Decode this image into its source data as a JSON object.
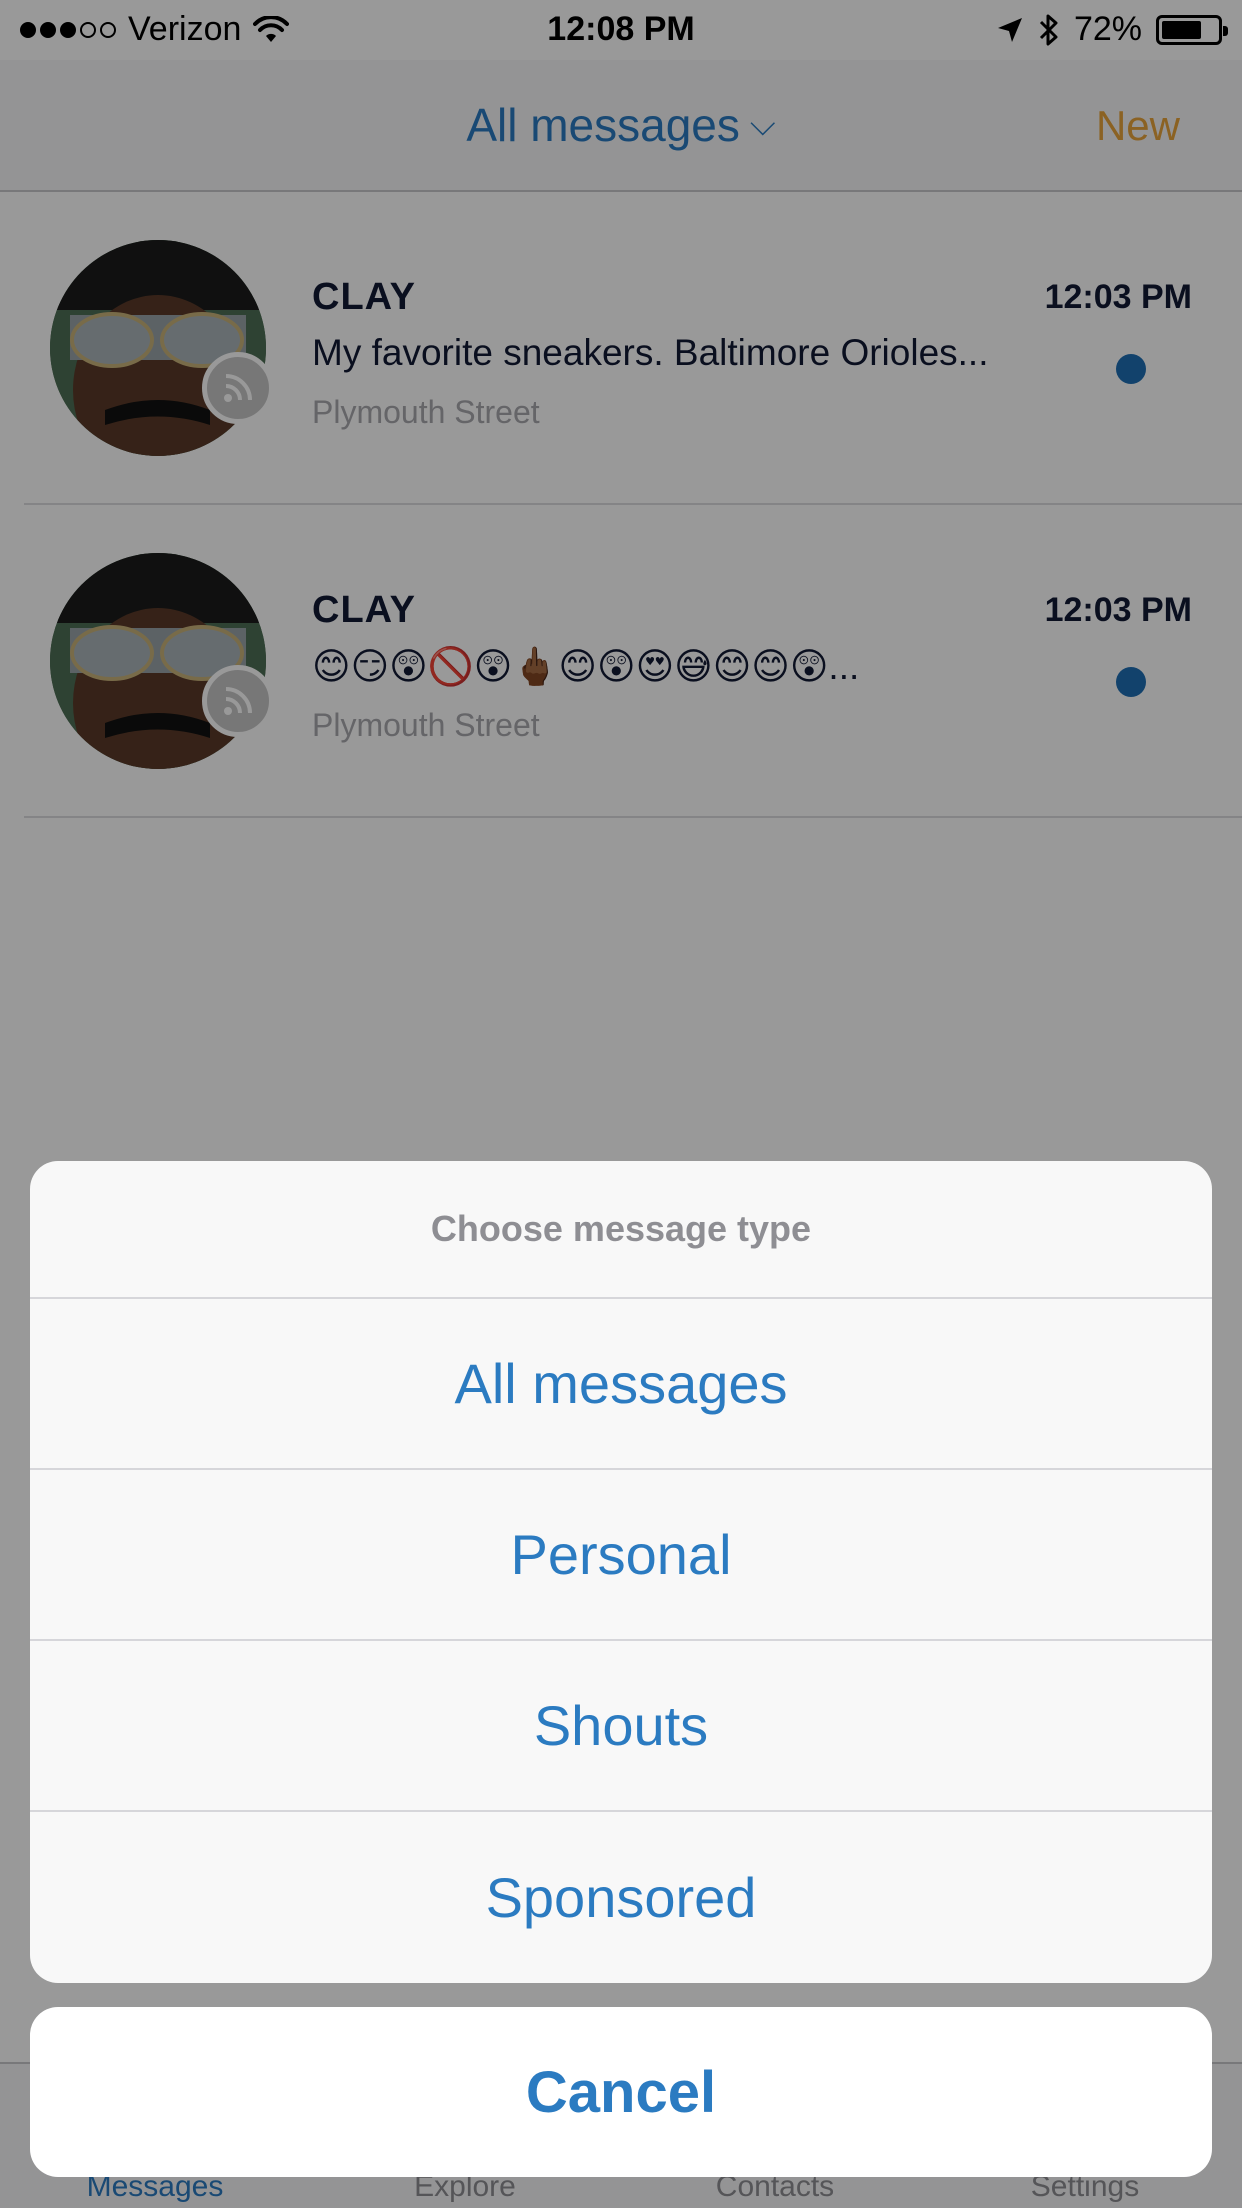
{
  "status_bar": {
    "carrier": "Verizon",
    "time": "12:08 PM",
    "battery": "72%",
    "battery_level": 0.72,
    "signal_bars": 3,
    "signal_total": 5
  },
  "nav": {
    "title": "All messages",
    "title_icon": "chevron-down-icon",
    "new_label": "New"
  },
  "messages": [
    {
      "name": "CLAY",
      "time": "12:03 PM",
      "preview": "My favorite sneakers. Baltimore Orioles...",
      "location": "Plymouth Street",
      "unread": true
    },
    {
      "name": "CLAY",
      "time": "12:03 PM",
      "preview": "😊😏😲🚫😲🖕🏾😊😲😍😅😊😊😲...",
      "location": "Plymouth Street",
      "unread": true
    }
  ],
  "tabs": [
    {
      "label": "Messages",
      "active": true
    },
    {
      "label": "Explore",
      "active": false
    },
    {
      "label": "Contacts",
      "active": false
    },
    {
      "label": "Settings",
      "active": false
    }
  ],
  "action_sheet": {
    "title": "Choose message type",
    "options": [
      "All messages",
      "Personal",
      "Shouts",
      "Sponsored"
    ],
    "cancel_label": "Cancel"
  },
  "colors": {
    "accent_blue": "#2b7bc1",
    "new_orange": "#e8a33b",
    "unread_dot": "#1f6fb4"
  }
}
